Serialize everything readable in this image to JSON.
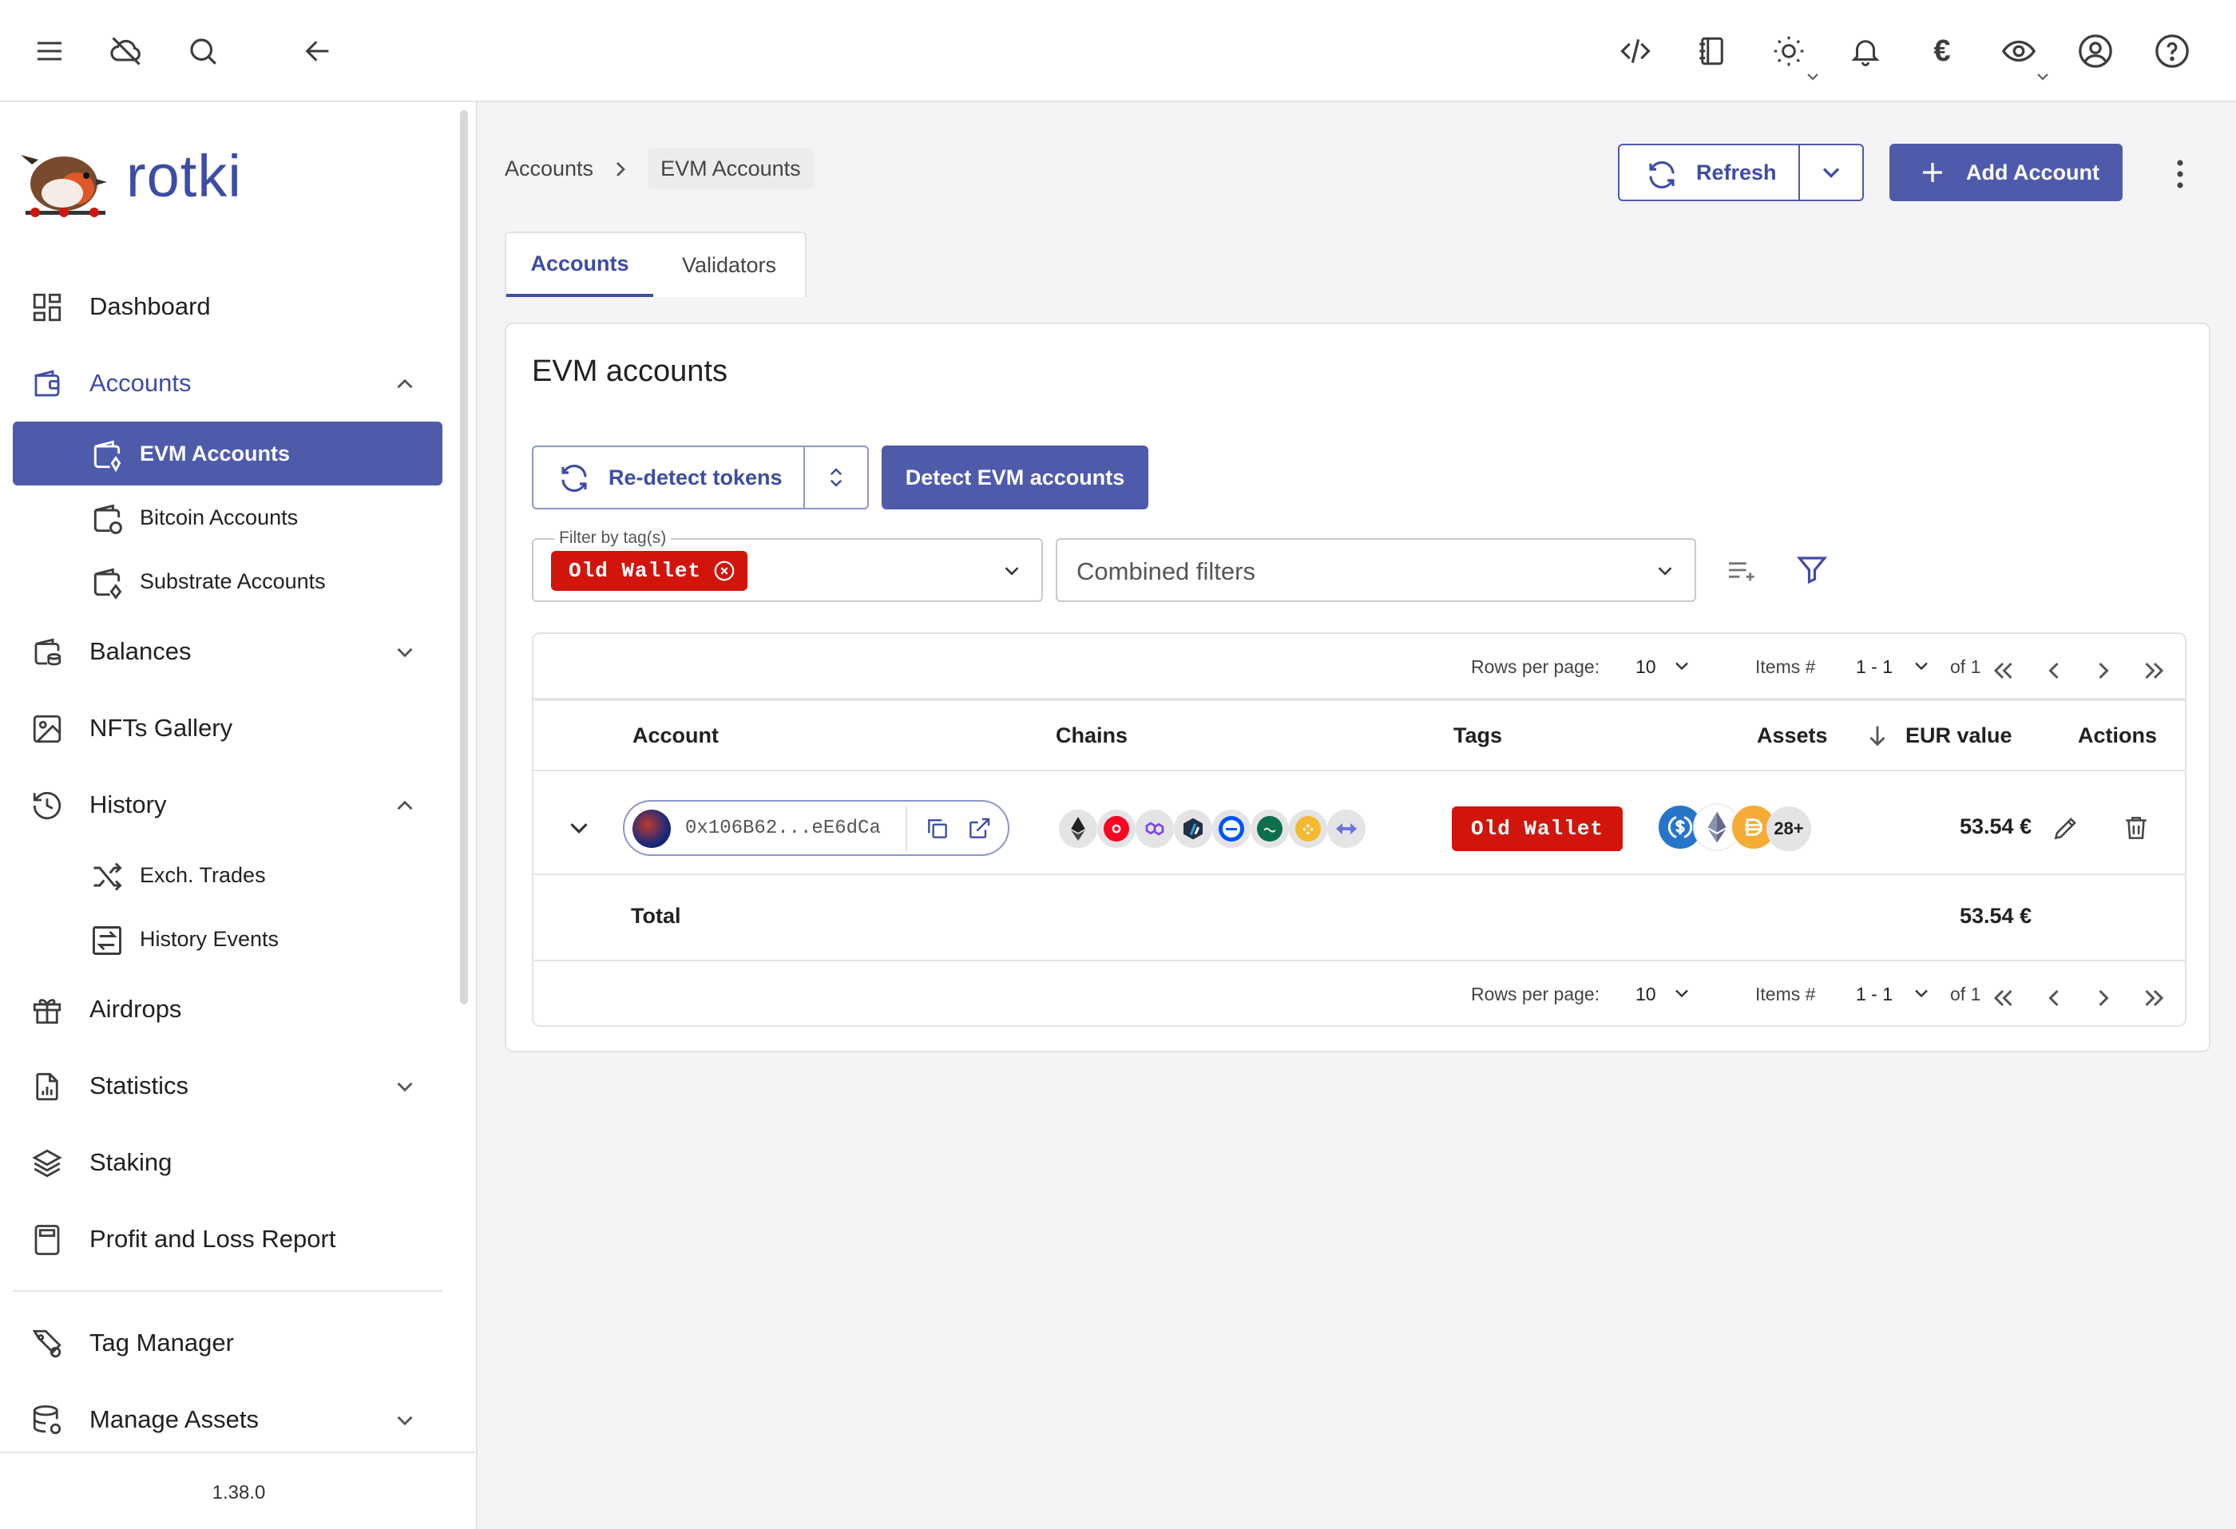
{
  "app": {
    "name": "rotki",
    "version": "1.38.0"
  },
  "topbar": {
    "icons": [
      "menu-icon",
      "cloud-off-icon",
      "search-icon",
      "back-arrow-icon",
      "code-icon",
      "notes-icon",
      "theme-sun-icon",
      "bell-icon",
      "currency-euro-icon",
      "privacy-eye-icon",
      "user-account-icon",
      "help-icon"
    ],
    "currency_symbol": "€"
  },
  "sidebar": {
    "items": [
      {
        "label": "Dashboard"
      },
      {
        "label": "Accounts"
      },
      {
        "label": "EVM Accounts"
      },
      {
        "label": "Bitcoin Accounts"
      },
      {
        "label": "Substrate Accounts"
      },
      {
        "label": "Balances"
      },
      {
        "label": "NFTs Gallery"
      },
      {
        "label": "History"
      },
      {
        "label": "Exch. Trades"
      },
      {
        "label": "History Events"
      },
      {
        "label": "Airdrops"
      },
      {
        "label": "Statistics"
      },
      {
        "label": "Staking"
      },
      {
        "label": "Profit and Loss Report"
      },
      {
        "label": "Tag Manager"
      },
      {
        "label": "Manage Assets"
      }
    ]
  },
  "breadcrumb": {
    "parent": "Accounts",
    "current": "EVM Accounts"
  },
  "toolbar": {
    "refresh_label": "Refresh",
    "add_account_label": "Add Account"
  },
  "tabs": [
    {
      "label": "Accounts"
    },
    {
      "label": "Validators"
    }
  ],
  "card": {
    "title": "EVM accounts",
    "redetect_label": "Re-detect tokens",
    "detect_label": "Detect EVM accounts",
    "tag_filter_label": "Filter by tag(s)",
    "tag_filter_value": "Old Wallet",
    "combined_filters_placeholder": "Combined filters"
  },
  "pager": {
    "rows_per_page_label": "Rows per page:",
    "rows_per_page": "10",
    "items_label": "Items #",
    "items_range": "1 - 1",
    "of_label": "of 1"
  },
  "table": {
    "headers": {
      "account": "Account",
      "chains": "Chains",
      "tags": "Tags",
      "assets": "Assets",
      "value": "EUR value",
      "actions": "Actions"
    },
    "rows": [
      {
        "address": "0x106B62...eE6dCa",
        "tag": "Old Wallet",
        "assets_more": "28+",
        "value": "53.54 €"
      }
    ],
    "total_label": "Total",
    "total_value": "53.54 €"
  },
  "colors": {
    "primary": "#4e5bab",
    "tag_red": "#d1150d"
  }
}
